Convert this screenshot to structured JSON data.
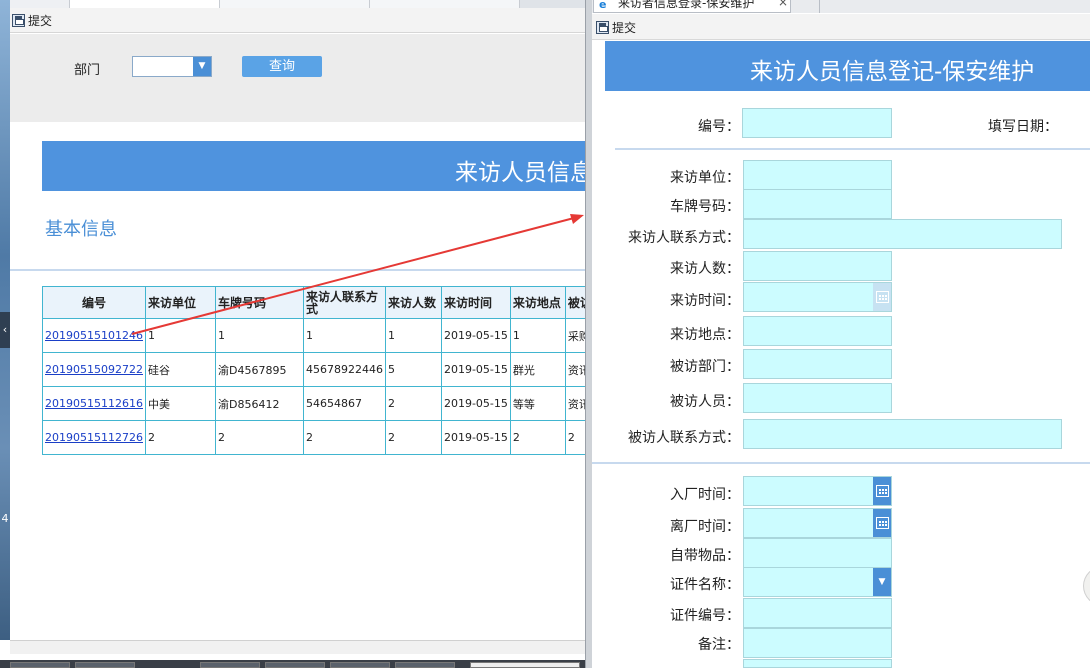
{
  "left_window": {
    "toolbar": {
      "submit_label": "提交"
    },
    "search": {
      "department_label": "部门",
      "department_value": "",
      "query_label": "查询"
    },
    "banner_title": "来访人员信息",
    "section_title": "基本信息",
    "table": {
      "headers": [
        "编号",
        "来访单位",
        "车牌号码",
        "来访人联系方式",
        "来访人数",
        "来访时间",
        "来访地点",
        "被访部"
      ],
      "rows": [
        [
          "20190515101246",
          "1",
          "1",
          "1",
          "1",
          "2019-05-15",
          "1",
          "采购"
        ],
        [
          "20190515092722",
          "硅谷",
          "渝D4567895",
          "45678922446",
          "5",
          "2019-05-15",
          "群光",
          "资讯部"
        ],
        [
          "20190515112616",
          "中美",
          "渝D856412",
          "54654867",
          "2",
          "2019-05-15",
          "等等",
          "资讯部"
        ],
        [
          "20190515112726",
          "2",
          "2",
          "2",
          "2",
          "2019-05-15",
          "2",
          "2"
        ]
      ]
    },
    "side_arrow": "‹",
    "side_number": "4"
  },
  "dialog": {
    "tab_title": "来访者信息登录-保安维护",
    "tab_close": "×",
    "tab_icon": "e",
    "toolbar": {
      "submit_label": "提交"
    },
    "banner_title": "来访人员信息登记-保安维护",
    "fields": {
      "id_label": "编号：",
      "fill_date_label": "填写日期：",
      "unit_label": "来访单位：",
      "plate_label": "车牌号码：",
      "contact_label": "来访人联系方式：",
      "count_label": "来访人数：",
      "time_label": "来访时间：",
      "place_label": "来访地点：",
      "dept_label": "被访部门：",
      "person_label": "被访人员：",
      "person_contact_label": "被访人联系方式：",
      "enter_label": "入厂时间：",
      "leave_label": "离厂时间：",
      "items_label": "自带物品：",
      "cert_name_label": "证件名称：",
      "cert_no_label": "证件编号：",
      "remark_label": "备注："
    }
  },
  "colors": {
    "banner": "#4f93de",
    "input_bg": "#ccfcff",
    "table_border": "#41b5d0",
    "link": "#1a3fc7",
    "arrow": "#e53935"
  },
  "icons": [
    "save-icon",
    "dropdown-arrow-icon",
    "calendar-icon",
    "ie-icon",
    "close-icon"
  ]
}
